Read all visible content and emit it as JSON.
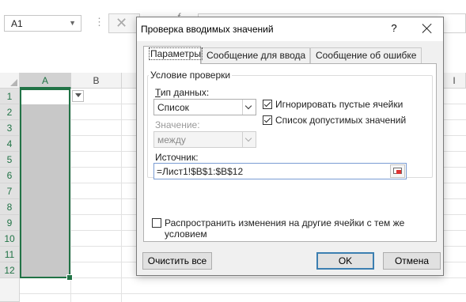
{
  "excel": {
    "name_box": "A1",
    "formula_bar_fragment": "f",
    "columns": [
      "A",
      "B",
      "I"
    ],
    "rows": [
      "1",
      "2",
      "3",
      "4",
      "5",
      "6",
      "7",
      "8",
      "9",
      "10",
      "11",
      "12"
    ]
  },
  "dialog": {
    "title": "Проверка вводимых значений",
    "help": "?",
    "tabs": [
      "Параметры",
      "Сообщение для ввода",
      "Сообщение об ошибке"
    ],
    "group_label": "Условие проверки",
    "data_type_label": "Тип данных:",
    "data_type_value": "Список",
    "ignore_blank_label": "Игнорировать пустые ячейки",
    "ignore_blank_checked": true,
    "in_cell_dropdown_label": "Список допустимых значений",
    "in_cell_dropdown_checked": true,
    "value_label": "Значение:",
    "value_value": "между",
    "source_label": "Источник:",
    "source_value": "=Лист1!$B$1:$B$12",
    "apply_all_label": "Распространить изменения на другие ячейки с тем же условием",
    "apply_all_checked": false,
    "clear_all": "Очистить все",
    "ok": "OK",
    "cancel": "Отмена"
  }
}
